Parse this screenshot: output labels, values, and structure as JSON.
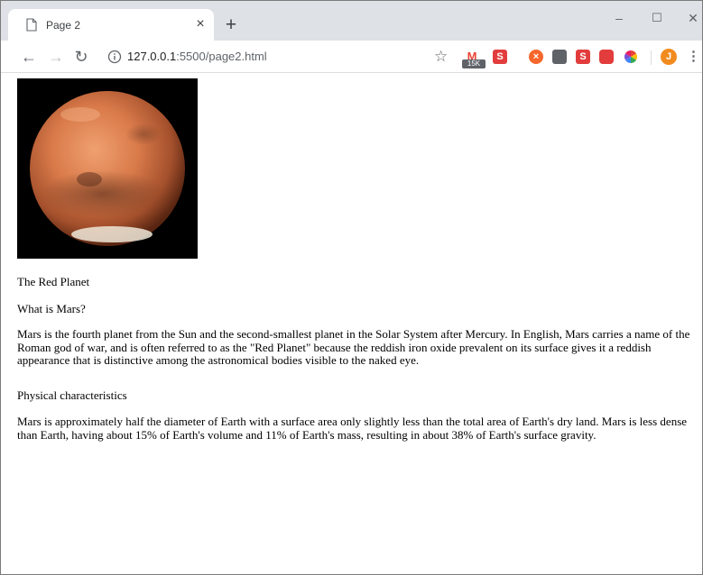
{
  "browser": {
    "tab": {
      "title": "Page 2",
      "close_glyph": "×",
      "icon": "page-icon"
    },
    "new_tab_glyph": "+",
    "window_controls": {
      "minimize": "–",
      "maximize": "☐",
      "close": "✕"
    },
    "toolbar": {
      "back_icon": "back-arrow-icon",
      "forward_icon": "forward-arrow-icon",
      "reload_icon": "reload-icon",
      "url_host": "127.0.0.1",
      "url_rest": ":5500/page2.html",
      "bookmark_icon": "star-icon",
      "gmail_badge": "15K",
      "extensions": [
        {
          "name": "gmail-extension-icon",
          "label": "M",
          "color": "#ea4335"
        },
        {
          "name": "s-extension-icon",
          "label": "S",
          "color": "#e23c3c"
        },
        {
          "name": "cancel-extension-icon",
          "label": "⊗",
          "color": "#f5672c"
        },
        {
          "name": "shield-extension-icon",
          "label": "◘",
          "color": "#5f6368"
        },
        {
          "name": "s-red-extension-icon",
          "label": "S",
          "color": "#e23c3c"
        },
        {
          "name": "record-extension-icon",
          "label": "▣",
          "color": "#e23c3c"
        },
        {
          "name": "color-wheel-extension-icon",
          "label": "◉",
          "color": "#7b4fd6"
        }
      ],
      "avatar_letter": "J",
      "menu_glyph": "⋮"
    }
  },
  "page": {
    "image_alt": "Mars",
    "heading": "The Red Planet",
    "question": "What is Mars?",
    "paragraph1": "Mars is the fourth planet from the Sun and the second-smallest planet in the Solar System after Mercury. In English, Mars carries a name of the Roman god of war, and is often referred to as the \"Red Planet\" because the reddish iron oxide prevalent on its surface gives it a reddish appearance that is distinctive among the astronomical bodies visible to the naked eye.",
    "subheading": "Physical characteristics",
    "paragraph2": "Mars is approximately half the diameter of Earth with a surface area only slightly less than the total area of Earth's dry land. Mars is less dense than Earth, having about 15% of Earth's volume and 11% of Earth's mass, resulting in about 38% of Earth's surface gravity."
  }
}
